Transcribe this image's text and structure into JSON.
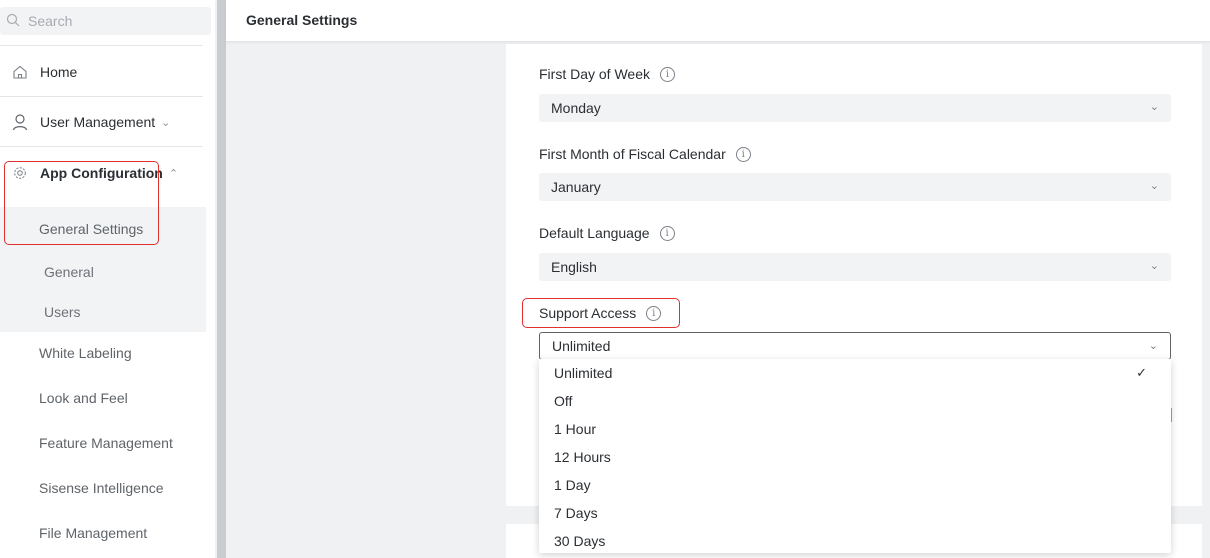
{
  "search": {
    "placeholder": "Search"
  },
  "sidebar": {
    "home": "Home",
    "user_management": "User Management",
    "app_configuration": "App Configuration",
    "general_settings": "General Settings",
    "sub_items": [
      "General",
      "Users"
    ],
    "items": [
      "White Labeling",
      "Look and Feel",
      "Feature Management",
      "Sisense Intelligence",
      "File Management"
    ]
  },
  "header": {
    "title": "General Settings"
  },
  "fields": [
    {
      "label": "First Day of Week",
      "value": "Monday"
    },
    {
      "label": "First Month of Fiscal Calendar",
      "value": "January"
    },
    {
      "label": "Default Language",
      "value": "English"
    },
    {
      "label": "Support Access",
      "value": "Unlimited"
    }
  ],
  "dropdown": {
    "options": [
      "Unlimited",
      "Off",
      "1 Hour",
      "12 Hours",
      "1 Day",
      "7 Days",
      "30 Days"
    ],
    "selected": "Unlimited"
  },
  "colors": {
    "highlight": "#e0312f",
    "sidebar_bg": "#ffffff",
    "select_bg": "#f2f3f5"
  },
  "icons": [
    "search-icon",
    "home-icon",
    "user-icon",
    "gear-icon",
    "chevron-down-icon",
    "chevron-up-icon",
    "info-icon",
    "check-icon"
  ]
}
